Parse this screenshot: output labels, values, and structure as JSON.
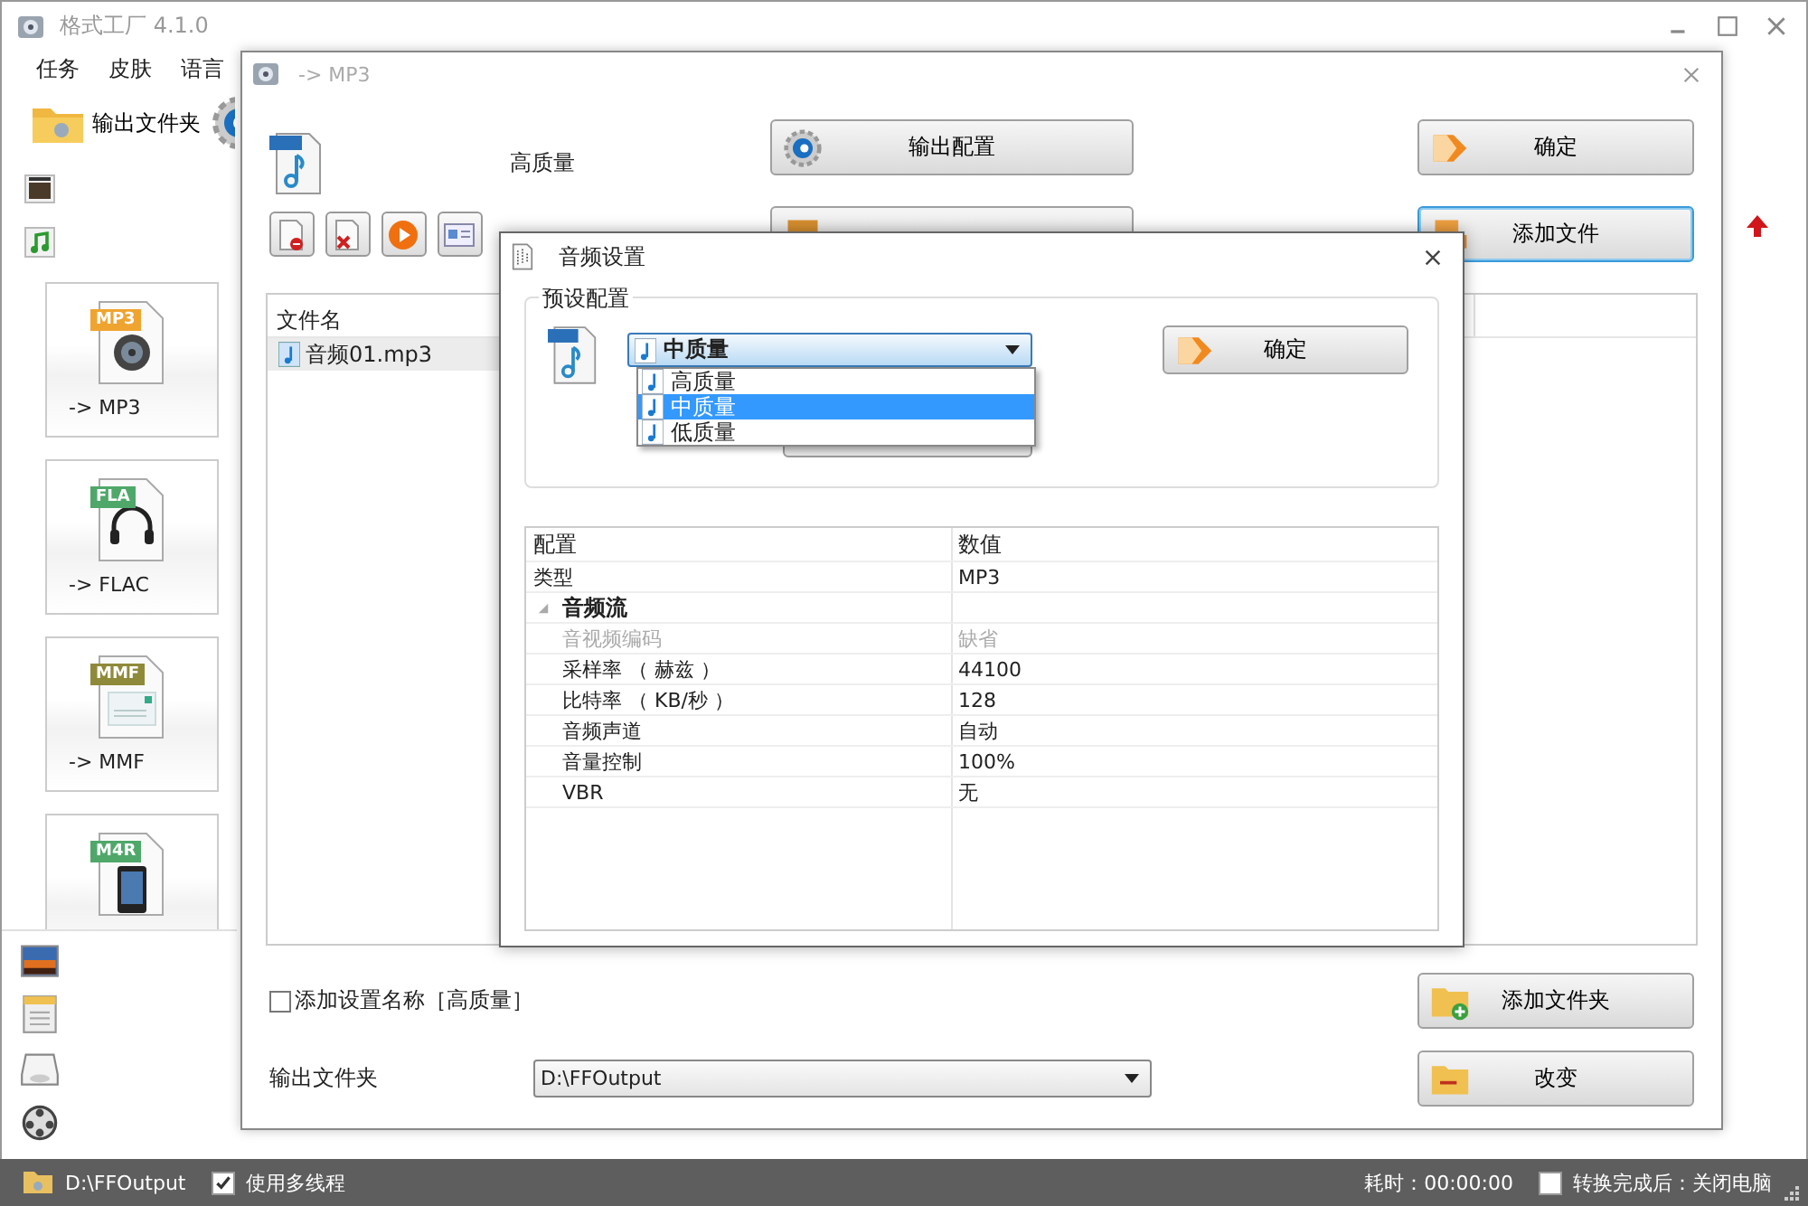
{
  "main_window": {
    "title": "格式工厂 4.1.0",
    "menu": [
      {
        "label": "任务"
      },
      {
        "label": "皮肤"
      },
      {
        "label": "语言"
      }
    ],
    "toolbar": [
      {
        "label": "输出文件夹"
      }
    ],
    "formats": [
      {
        "tag": "MP3",
        "label": "-> MP3",
        "color": "#f0a430",
        "kind": "speaker"
      },
      {
        "tag": "FLA",
        "label": "-> FLAC",
        "color": "#4fa86a",
        "kind": "headset"
      },
      {
        "tag": "MMF",
        "label": "-> MMF",
        "color": "#8f8a3a",
        "kind": "document"
      },
      {
        "tag": "M4R",
        "color": "#4fa86a",
        "kind": "phone"
      }
    ]
  },
  "convert_window": {
    "title": "-> MP3",
    "preset": "高质量",
    "buttons": [
      {
        "kind": "config",
        "label": "输出配置",
        "focused": false
      },
      {
        "kind": "ok",
        "label": "确定",
        "focused": false
      },
      {
        "kind": "clip",
        "focused": false
      },
      {
        "kind": "add",
        "label": "添加文件",
        "focused": true
      }
    ],
    "file_list": {
      "header": "文件名",
      "rows": [
        {
          "name": "音频01.mp3",
          "selected": true
        }
      ]
    },
    "add_name": {
      "label": "添加设置名称［高质量］",
      "checked": false
    },
    "output_folder": {
      "label": "输出文件夹",
      "value": "D:\\FFOutput"
    },
    "bottom_buttons": [
      {
        "kind": "folder",
        "label": "添加文件夹"
      },
      {
        "kind": "change",
        "label": "改变"
      }
    ]
  },
  "audio_dialog": {
    "title": "音频设置",
    "preset_group": {
      "legend": "预设配置",
      "select": {
        "value": "中质量",
        "expanded": true,
        "options": [
          {
            "label": "高质量",
            "selected": false
          },
          {
            "label": "中质量",
            "selected": true
          },
          {
            "label": "低质量",
            "selected": false
          }
        ]
      },
      "ok": "确定"
    },
    "grid": {
      "columns": [
        "配置",
        "数值"
      ],
      "rows": [
        {
          "name": "类型",
          "value": "MP3"
        },
        {
          "name": "音频流",
          "expanded": true,
          "children": [
            {
              "name": "音视频编码",
              "value": "缺省",
              "disabled": true
            },
            {
              "name": "采样率 （ 赫兹 ）",
              "value": "44100",
              "disabled": false
            },
            {
              "name": "比特率 （ KB/秒 ）",
              "value": "128",
              "disabled": false
            },
            {
              "name": "音频声道",
              "value": "自动",
              "disabled": false
            },
            {
              "name": "音量控制",
              "value": "100%",
              "disabled": false
            },
            {
              "name": "VBR",
              "value": "无",
              "disabled": false
            }
          ]
        }
      ]
    }
  },
  "status_bar": {
    "folder": "D:\\FFOutput",
    "multithread": {
      "label": "使用多线程",
      "checked": true
    },
    "elapsed": "耗时：00:00:00",
    "shutdown": {
      "label": "转换完成后：关闭电脑",
      "checked": false
    }
  }
}
